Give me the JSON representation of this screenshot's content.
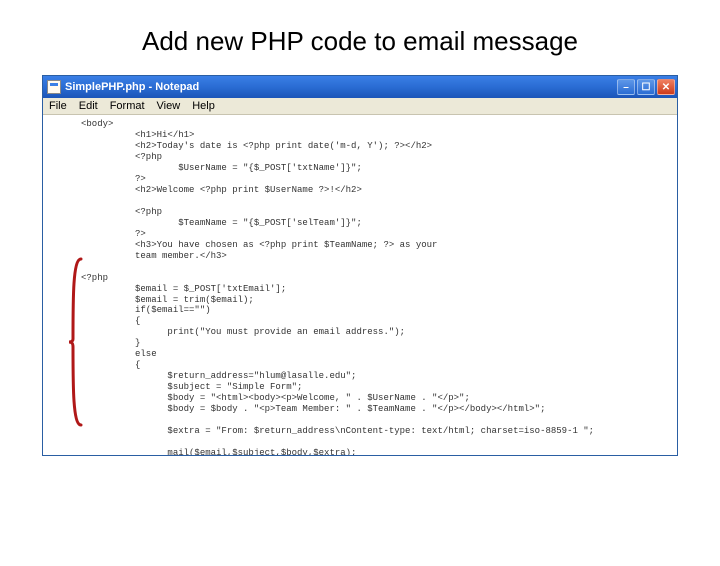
{
  "slide": {
    "title": "Add new PHP code to email message"
  },
  "window": {
    "title": "SimplePHP.php - Notepad"
  },
  "menu": {
    "file": "File",
    "edit": "Edit",
    "format": "Format",
    "view": "View",
    "help": "Help"
  },
  "code": "<body>\n          <h1>Hi</h1>\n          <h2>Today's date is <?php print date('m-d, Y'); ?></h2>\n          <?php\n                  $UserName = \"{$_POST['txtName']}\";\n          ?>\n          <h2>Welcome <?php print $UserName ?>!</h2>\n\n          <?php\n                  $TeamName = \"{$_POST['selTeam']}\";\n          ?>\n          <h3>You have chosen as <?php print $TeamName; ?> as your\n          team member.</h3>\n\n<?php\n          $email = $_POST['txtEmail'];\n          $email = trim($email);\n          if($email==\"\")\n          {\n                print(\"You must provide an email address.\");\n          }\n          else\n          {\n                $return_address=\"hlum@lasalle.edu\";\n                $subject = \"Simple Form\";\n                $body = \"<html><body><p>Welcome, \" . $UserName . \"</p>\";\n                $body = $body . \"<p>Team Member: \" . $TeamName . \"</p></body></html>\";\n\n                $extra = \"From: $return_address\\nContent-type: text/html; charset=iso-8859-1 \";\n\n                mail($email,$subject,$body,$extra);\n          }\n?>\n     </body>\n</html>"
}
